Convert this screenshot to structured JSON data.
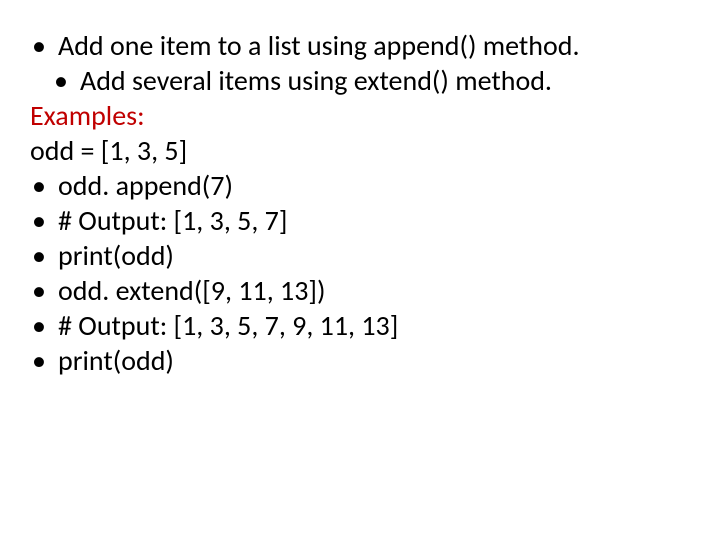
{
  "lines": {
    "l1": "Add one item to a list using append() method.",
    "l2": "Add several items using extend() method.",
    "l3": "Examples:",
    "l4": "odd = [1, 3, 5]",
    "l5": "odd. append(7)",
    "l6": "# Output: [1, 3, 5, 7]",
    "l7": "print(odd)",
    "l8": "odd. extend([9, 11, 13])",
    "l9": "# Output: [1, 3, 5, 7, 9, 11, 13]",
    "l10": "print(odd)"
  },
  "bullet": "•"
}
